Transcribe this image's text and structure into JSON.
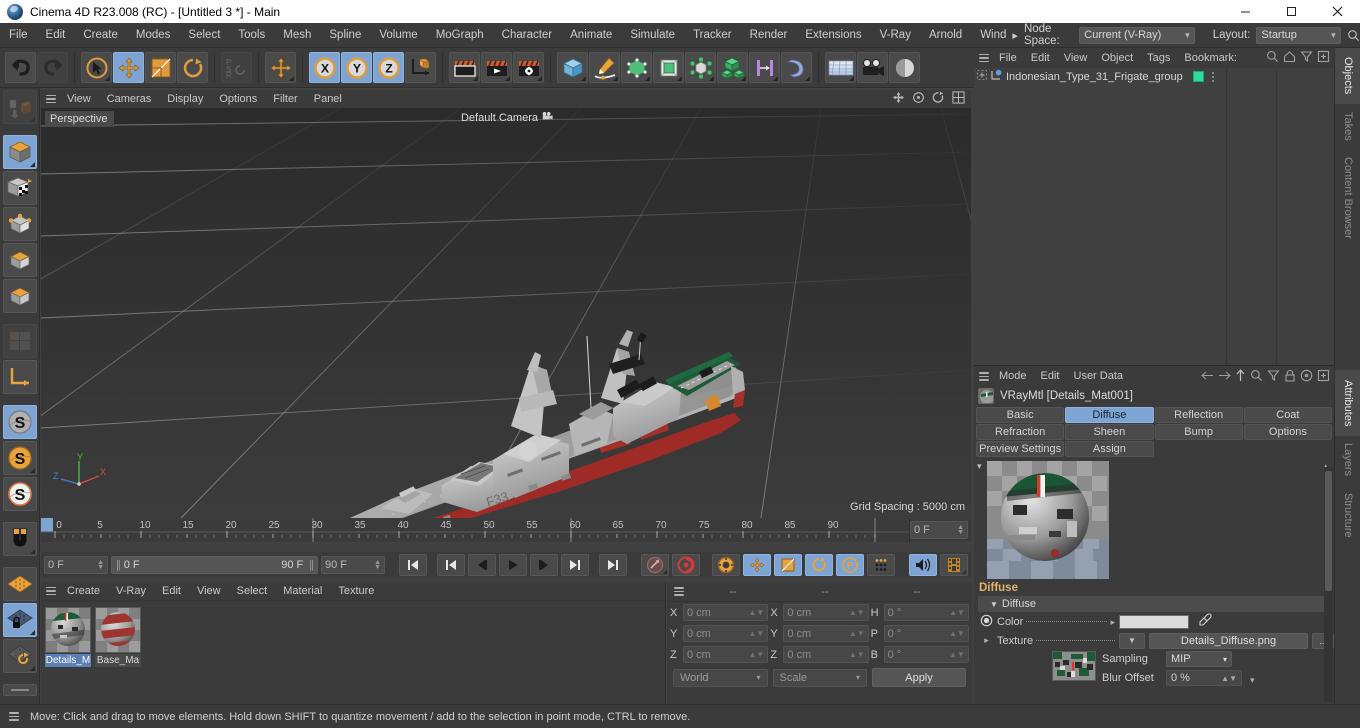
{
  "window": {
    "title": "Cinema 4D R23.008 (RC) - [Untitled 3 *] - Main",
    "app_icon": "c4d-logo-icon",
    "minimize": "minimize-icon",
    "maximize": "maximize-icon",
    "close": "close-icon"
  },
  "menubar": {
    "items": [
      "File",
      "Edit",
      "Create",
      "Modes",
      "Select",
      "Tools",
      "Mesh",
      "Spline",
      "Volume",
      "MoGraph",
      "Character",
      "Animate",
      "Simulate",
      "Tracker",
      "Render",
      "Extensions",
      "V-Ray",
      "Arnold",
      "Wind"
    ],
    "overflow": "▸",
    "node_space_label": "Node Space:",
    "node_space_value": "Current (V-Ray)",
    "layout_label": "Layout:",
    "layout_value": "Startup",
    "search_icon": "search-icon"
  },
  "toolbar": {
    "undo": "undo-icon",
    "redo": "redo-icon",
    "live_selection": "live-selection-icon",
    "move": "move-tool-icon",
    "scale": "scale-tool-icon",
    "rotate": "rotate-tool-icon",
    "psr": "psr-lock-icon",
    "move_world": "move-world-icon",
    "axis_x": "X",
    "axis_y": "Y",
    "axis_z": "Z",
    "world_object_axis": "world-object-axis-icon",
    "render_view": "render-view-icon",
    "render_picture_viewer": "render-picture-viewer-icon",
    "render_settings": "render-settings-icon",
    "cube": "primitive-cube-icon",
    "pen": "spline-pen-icon",
    "subdivision": "subdivision-surface-icon",
    "extrude": "extrude-nurbs-icon",
    "array": "array-icon",
    "cloner": "mograph-cloner-icon",
    "instance": "instance-icon",
    "deformer": "bend-deformer-icon",
    "floor": "floor-environment-icon",
    "camera": "camera-icon",
    "light": "light-icon"
  },
  "left_tools": [
    {
      "name": "undo-view-icon",
      "active": false,
      "disabled": true
    },
    {
      "name": "object-mode-icon",
      "active": true,
      "disabled": false
    },
    {
      "name": "texture-mode-icon",
      "active": false,
      "disabled": false
    },
    {
      "name": "point-mode-icon",
      "active": false,
      "disabled": false
    },
    {
      "name": "edge-mode-icon",
      "active": false,
      "disabled": false
    },
    {
      "name": "polygon-mode-icon",
      "active": false,
      "disabled": false
    },
    {
      "name": "uv-mode-icon",
      "active": false,
      "disabled": true
    },
    {
      "name": "axis-modify-icon",
      "active": false,
      "disabled": false
    },
    {
      "name": "enable-snap-icon",
      "active": true,
      "disabled": false
    },
    {
      "name": "snap-settings-icon",
      "active": false,
      "disabled": false
    },
    {
      "name": "workplane-snap-icon",
      "active": false,
      "disabled": false
    },
    {
      "name": "magnet-tool-icon",
      "active": false,
      "disabled": false
    },
    {
      "name": "workplane-icon",
      "active": false,
      "disabled": false
    },
    {
      "name": "lock-workplane-icon",
      "active": true,
      "disabled": false
    },
    {
      "name": "planar-workplane-icon",
      "active": false,
      "disabled": false
    }
  ],
  "viewport": {
    "menu": [
      "View",
      "Cameras",
      "Display",
      "Options",
      "Filter",
      "Panel"
    ],
    "perspective_label": "Perspective",
    "camera_label": "Default Camera",
    "camera_icon": "camera-small-icon",
    "grid_spacing": "Grid Spacing : 5000 cm",
    "axis": {
      "x": "X",
      "y": "Y",
      "z": "Z"
    },
    "model": "indonesian-type-31-frigate",
    "hull_number": "F33",
    "colors": {
      "bg_top": "#2e2e2e",
      "bg_bottom": "#3a3a3a",
      "hull_grey": "#b9b9b9",
      "hull_red": "#9e2b25",
      "deck_green": "#1e5a37",
      "axis_x": "#d04a4a",
      "axis_y": "#4ad04a",
      "axis_z": "#4a7ad0"
    },
    "view_icons": [
      "move-view-icon",
      "scale-view-icon",
      "rotate-view-icon",
      "layout-view-icon"
    ]
  },
  "timeline": {
    "ticks": [
      "0",
      "5",
      "10",
      "15",
      "20",
      "25",
      "30",
      "35",
      "40",
      "45",
      "50",
      "55",
      "60",
      "65",
      "70",
      "75",
      "80",
      "85",
      "90"
    ],
    "min_frame": 0,
    "max_frame": 90,
    "current_frame_field": "0 F",
    "start_field": "0 F",
    "range_start": "0 F",
    "range_end": "90 F",
    "end_field": "90 F"
  },
  "transport": {
    "buttons": [
      {
        "name": "go-to-start-button",
        "glyph": "|◀",
        "active": false
      },
      {
        "name": "go-to-previous-key-button",
        "glyph": "|◀",
        "active": false
      },
      {
        "name": "step-back-button",
        "glyph": "◀|",
        "active": false
      },
      {
        "name": "play-button",
        "glyph": "▶",
        "active": false
      },
      {
        "name": "step-forward-button",
        "glyph": "|▶",
        "active": false
      },
      {
        "name": "go-to-next-key-button",
        "glyph": "▶|",
        "active": false
      },
      {
        "name": "go-to-end-button",
        "glyph": "▶|",
        "active": false
      }
    ],
    "record_key": "record-active-objects-icon",
    "autokey": "autokeying-icon",
    "keyframe_settings": "keyframe-selection-icon",
    "key_position": "key-position-icon",
    "key_scale": "key-scale-icon",
    "key_rotation": "key-rotation-icon",
    "key_param": "key-parameter-icon",
    "key_pla": "key-point-level-animation-icon",
    "sound": "sound-icon",
    "filmstrip": "timeline-view-icon"
  },
  "material_manager": {
    "menu": [
      "Create",
      "V-Ray",
      "Edit",
      "View",
      "Select",
      "Material",
      "Texture"
    ],
    "materials": [
      {
        "name": "Details_M",
        "selected": true,
        "thumb": "details-material-thumb"
      },
      {
        "name": "Base_Ma",
        "selected": false,
        "thumb": "base-material-thumb"
      }
    ]
  },
  "coordinates": {
    "headers": [
      "--",
      "--",
      "--"
    ],
    "rows": [
      {
        "pos_label": "X",
        "pos_value": "0 cm",
        "size_label": "X",
        "size_value": "0 cm",
        "rot_label": "H",
        "rot_value": "0 °"
      },
      {
        "pos_label": "Y",
        "pos_value": "0 cm",
        "size_label": "Y",
        "size_value": "0 cm",
        "rot_label": "P",
        "rot_value": "0 °"
      },
      {
        "pos_label": "Z",
        "pos_value": "0 cm",
        "size_label": "Z",
        "size_value": "0 cm",
        "rot_label": "B",
        "rot_value": "0 °"
      }
    ],
    "coord_system": "World",
    "size_mode": "Scale",
    "apply_label": "Apply"
  },
  "object_manager": {
    "menu": [
      "File",
      "Edit",
      "View",
      "Object",
      "Tags",
      "Bookmark:"
    ],
    "icons": [
      "search-icon",
      "home-icon",
      "filter-icon",
      "add-icon"
    ],
    "objects": [
      {
        "name": "Indonesian_Type_31_Frigate_group",
        "icon": "null-object-icon",
        "tag_color": "#2ddc9a",
        "expandable": true
      }
    ]
  },
  "attributes": {
    "menu": [
      "Mode",
      "Edit",
      "User Data"
    ],
    "icons": [
      "back-icon",
      "forward-icon",
      "up-icon",
      "search-icon",
      "filter-icon",
      "lock-icon",
      "target-icon",
      "add-icon"
    ],
    "object_title": "VRayMtl [Details_Mat001]",
    "tabs_row1": [
      "Basic",
      "Diffuse",
      "Reflection",
      "Coat"
    ],
    "tabs_row2": [
      "Refraction",
      "Sheen",
      "Bump",
      "Options"
    ],
    "tabs_row3": [
      "Preview Settings",
      "Assign"
    ],
    "active_tab": "Diffuse",
    "section_title": "Diffuse",
    "group_title": "Diffuse",
    "color_label": "Color",
    "color_value": "#dcdcdc",
    "eyedropper": "eyedropper-icon",
    "texture_label": "Texture",
    "texture_value": "Details_Diffuse.png",
    "texture_browse": "...",
    "sampling_label": "Sampling",
    "sampling_value": "MIP",
    "blur_offset_label": "Blur Offset",
    "blur_offset_value": "0 %"
  },
  "vtabs_top": [
    {
      "label": "Objects",
      "active": true
    },
    {
      "label": "Takes",
      "active": false
    },
    {
      "label": "Content Browser",
      "active": false
    }
  ],
  "vtabs_bottom": [
    {
      "label": "Attributes",
      "active": true
    },
    {
      "label": "Layers",
      "active": false
    },
    {
      "label": "Structure",
      "active": false
    }
  ],
  "statusbar": {
    "menu_icon": "hamburger-icon",
    "text": "Move: Click and drag to move elements. Hold down SHIFT to quantize movement / add to the selection in point mode, CTRL to remove."
  }
}
